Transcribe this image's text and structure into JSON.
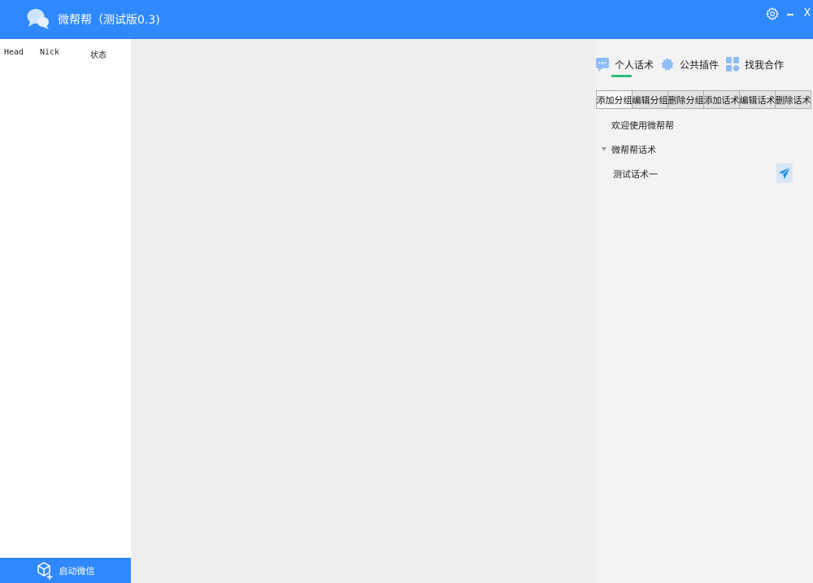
{
  "titlebar": {
    "title": "微帮帮（测试版0.3)",
    "close_glyph": "X",
    "icons": {
      "logo": "chat-bubbles-icon",
      "settings": "gear-icon",
      "minimize": "minimize-icon",
      "close": "close-icon"
    }
  },
  "contacts": {
    "columns": [
      "Head",
      "Nick",
      "状态"
    ],
    "rows": [],
    "start_button_label": "启动微信",
    "start_button_icon": "cube-plus-icon"
  },
  "right_panel": {
    "tabs": [
      {
        "label": "个人话术",
        "icon": "speech-bubble-icon",
        "active": true
      },
      {
        "label": "公共插件",
        "icon": "badge-icon",
        "active": false
      },
      {
        "label": "找我合作",
        "icon": "grid-icon",
        "active": false
      }
    ],
    "toolbar": [
      "添加分组",
      "编辑分组",
      "删除分组",
      "添加话术",
      "编辑话术",
      "删除话术"
    ],
    "tree": {
      "welcome": "欢迎使用微帮帮",
      "group": "微帮帮话术",
      "group_expanded": true,
      "item": "测试话术一",
      "send_icon": "paper-plane-icon"
    }
  },
  "colors": {
    "accent": "#2f89fc",
    "tab_indicator": "#2bbd7a",
    "background": "#eeeeee"
  }
}
